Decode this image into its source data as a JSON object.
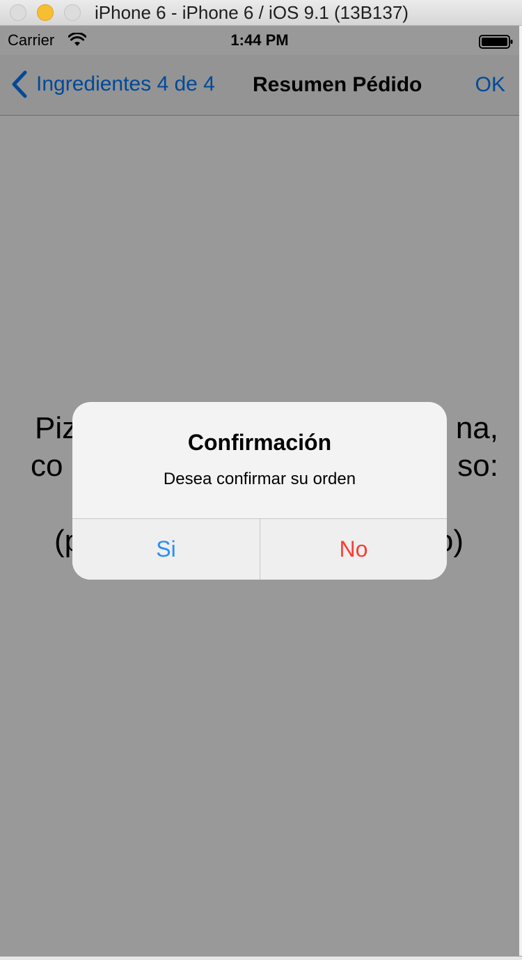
{
  "window": {
    "title": "iPhone 6 - iPhone 6 / iOS 9.1 (13B137)"
  },
  "status_bar": {
    "carrier": "Carrier",
    "time": "1:44 PM"
  },
  "nav_bar": {
    "back_label": "Ingredientes 4 de 4",
    "title": "Resumen Pédido",
    "right_label": "OK"
  },
  "content": {
    "summary_lines": [
      "Piz",
      "na,",
      "co",
      "so:",
      "(p",
      "o)"
    ]
  },
  "alert": {
    "title": "Confirmación",
    "message": "Desea confirmar su orden",
    "confirm_label": "Si",
    "cancel_label": "No"
  },
  "colors": {
    "ios_blue": "#007aff",
    "destructive_red": "#ff3b30"
  },
  "icons": [
    "chevron-left-icon",
    "wifi-icon",
    "battery-icon"
  ]
}
